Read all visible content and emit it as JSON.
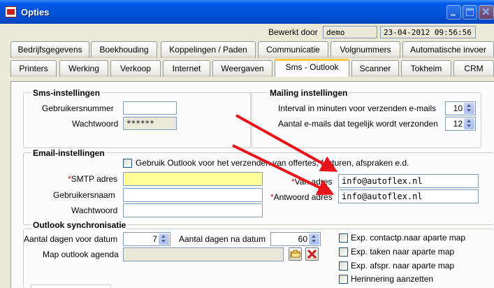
{
  "window": {
    "title": "Opties"
  },
  "header": {
    "edited_by_label": "Bewerkt door",
    "edited_by_value": "demo",
    "datetime": "23-04-2012 09:56:56"
  },
  "tabs_row1": [
    "Bedrijfsgegevens",
    "Boekhouding",
    "Koppelingen / Paden",
    "Communicatie",
    "Volgnummers",
    "Automatische invoer"
  ],
  "tabs_row2": [
    "Printers",
    "Werking",
    "Verkoop",
    "Internet",
    "Weergaven",
    "Sms - Outlook",
    "Scanner",
    "Tokheim",
    "CRM"
  ],
  "active_tab": "Sms - Outlook",
  "sms": {
    "title": "Sms-instellingen",
    "user_label": "Gebruikersnummer",
    "user_value": "",
    "password_label": "Wachtwoord",
    "password_value": "******"
  },
  "mailing": {
    "title": "Mailing instellingen",
    "interval_label": "Interval in minuten voor verzenden e-mails",
    "interval_value": "10",
    "count_label": "Aantal e-mails dat tegelijk wordt verzonden",
    "count_value": "12"
  },
  "email": {
    "title": "Email-instellingen",
    "use_outlook_label": "Gebruik Outlook voor het verzenden van offertes, facturen, afspraken e.d.",
    "use_outlook_checked": false,
    "smtp_label": "SMTP adres",
    "smtp_value": "",
    "username_label": "Gebruikersnaam",
    "username_value": "",
    "password_label": "Wachtwoord",
    "password_value": "",
    "from_label": "Van adres",
    "from_value": "info@autoflex.nl",
    "reply_label": "Antwoord adres",
    "reply_value": "info@autoflex.nl",
    "required_mark": "*"
  },
  "outlook": {
    "title": "Outlook synchronisatie",
    "days_before_label": "Aantal dagen voor datum",
    "days_before_value": "7",
    "days_after_label": "Aantal dagen na datum",
    "days_after_value": "60",
    "agenda_label": "Map outlook agenda",
    "agenda_value": "",
    "checkboxes": [
      {
        "label": "Exp. contactp.naar aparte map",
        "checked": false
      },
      {
        "label": "Exp. taken naar aparte map",
        "checked": false
      },
      {
        "label": "Exp. afspr. naar aparte map",
        "checked": false
      },
      {
        "label": "Herinnering aanzetten",
        "checked": false
      }
    ]
  },
  "colors": {
    "title_bar": "#0054e3",
    "required": "#e00000",
    "highlight_field": "#ffff99",
    "annotation_arrow": "#e8141a"
  },
  "icons": {
    "app": "app-icon",
    "minimize": "minimize-icon",
    "maximize": "maximize-icon",
    "close": "close-icon",
    "folder": "folder-icon",
    "delete": "delete-x-icon"
  }
}
